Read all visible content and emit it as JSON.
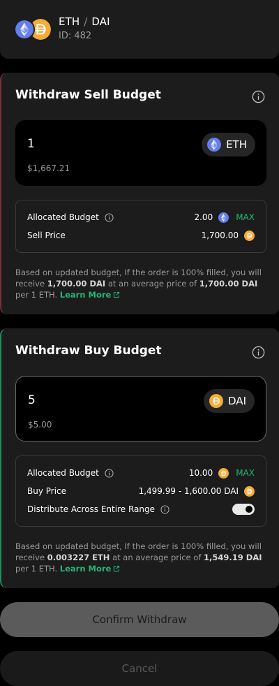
{
  "header": {
    "base": "ETH",
    "separator": "/",
    "quote": "DAI",
    "id_label": "ID: 482"
  },
  "icons": {
    "eth_color": "#627eea",
    "dai_color": "#f5ac37",
    "accent_green": "#25b574",
    "sell_border": "#7a2e35",
    "buy_border": "#1f8f5a"
  },
  "sell": {
    "title": "Withdraw Sell Budget",
    "amount": "1",
    "fiat": "$1,667.21",
    "token": "ETH",
    "allocated_label": "Allocated Budget",
    "allocated_value": "2.00",
    "max_label": "MAX",
    "price_label": "Sell Price",
    "price_value": "1,700.00",
    "note_1": "Based on updated budget, If the order is 100% filled, you will receive",
    "note_amount": "1,700.00 DAI",
    "note_2": "at an average price of",
    "note_price": "1,700.00 DAI",
    "note_3": "per 1 ETH.",
    "learn_more": "Learn More"
  },
  "buy": {
    "title": "Withdraw Buy Budget",
    "amount": "5",
    "fiat": "$5.00",
    "token": "DAI",
    "allocated_label": "Allocated Budget",
    "allocated_value": "10.00",
    "max_label": "MAX",
    "price_label": "Buy Price",
    "price_value": "1,499.99 - 1,600.00 DAI",
    "distribute_label": "Distribute Across Entire Range",
    "distribute_on": true,
    "note_1": "Based on updated budget, If the order is 100% filled, you will receive",
    "note_amount": "0.003227 ETH",
    "note_2": "at an average price of",
    "note_price": "1,549.19 DAI",
    "note_3": "per 1 ETH.",
    "learn_more": "Learn More"
  },
  "actions": {
    "confirm": "Confirm Withdraw",
    "cancel": "Cancel"
  }
}
